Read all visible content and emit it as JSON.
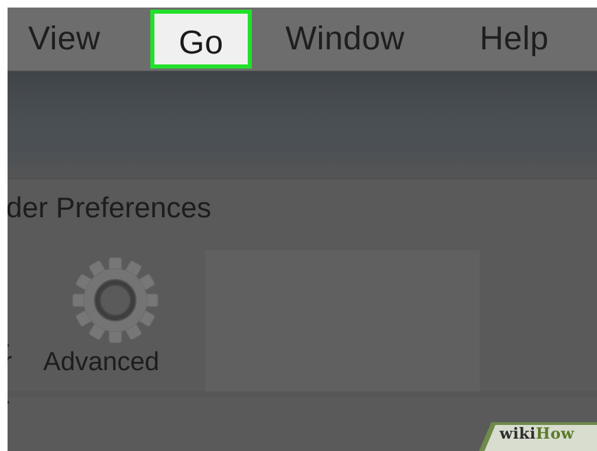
{
  "menubar": {
    "items": [
      {
        "label": "View"
      },
      {
        "label": "Go"
      },
      {
        "label": "Window"
      },
      {
        "label": "Help"
      }
    ],
    "highlighted": "Go",
    "highlight_color": "#22e02b"
  },
  "preferences": {
    "title": "der Preferences",
    "toolbar": {
      "partial_label": "r",
      "advanced_label": "Advanced",
      "advanced_icon": "gear-icon"
    }
  },
  "watermark": {
    "prefix": "wiki",
    "suffix": "How"
  }
}
